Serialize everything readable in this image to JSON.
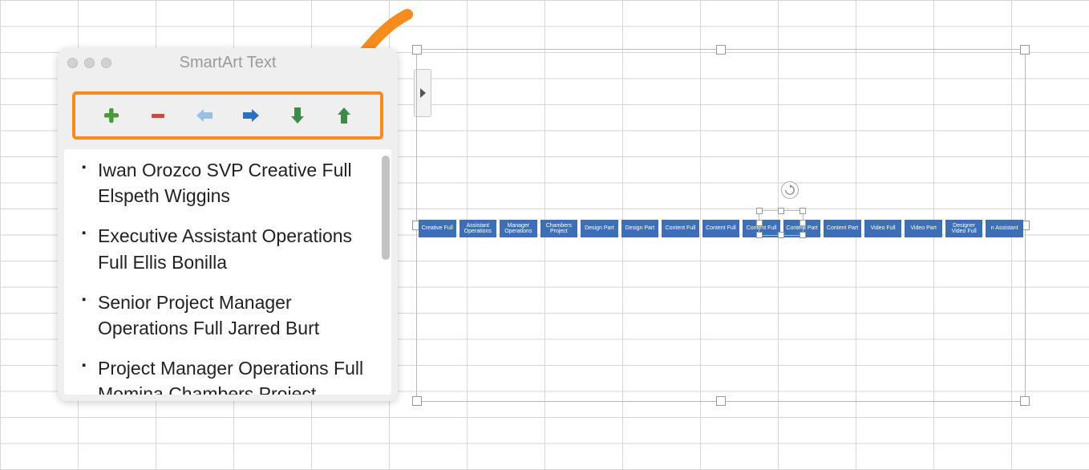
{
  "panel": {
    "title": "SmartArt Text",
    "toolbar": [
      {
        "name": "add",
        "icon": "plus",
        "color": "#4a9a3a"
      },
      {
        "name": "remove",
        "icon": "minus",
        "color": "#c94a3f"
      },
      {
        "name": "promote",
        "icon": "arrow-left",
        "color": "#9bbde9"
      },
      {
        "name": "demote",
        "icon": "arrow-right",
        "color": "#2b6fc0"
      },
      {
        "name": "move-down",
        "icon": "arrow-down",
        "color": "#3e8a4b"
      },
      {
        "name": "move-up",
        "icon": "arrow-up",
        "color": "#3e8a4b"
      }
    ],
    "items": [
      "Iwan Orozco  SVP Creative Full Elspeth Wiggins",
      "Executive Assistant Operations Full Ellis Bonilla",
      "Senior Project Manager Operations Full Jarred Burt",
      "Project Manager Operations Full Momina Chambers Project Specialist  Operations"
    ]
  },
  "annotation": {
    "arrow_color": "#f78c1e"
  },
  "smartart": {
    "nodes": [
      "Creative Full",
      "Assistant Operations",
      "Manager Operations",
      "Chambers Project",
      "Design Part",
      "Design Part",
      "Content Full",
      "Content Full",
      "Content Full",
      "Content Part",
      "Content Part",
      "Video Full",
      "Video Part",
      "Designer Video Full",
      "n Assistant"
    ]
  }
}
